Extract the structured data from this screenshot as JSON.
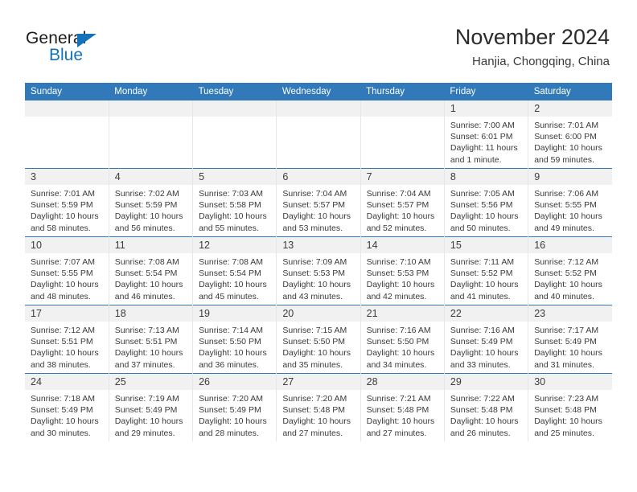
{
  "brand": {
    "name_part1": "General",
    "name_part2": "Blue",
    "triangle_icon": "triangle-icon",
    "primary_color": "#1272bc"
  },
  "header": {
    "title": "November 2024",
    "subtitle": "Hanjia, Chongqing, China"
  },
  "theme": {
    "header_blue": "#3179b8",
    "daynum_bg": "#f1f1f1",
    "cell_border": "#e6e6e6"
  },
  "labels": {
    "sunrise_prefix": "Sunrise:",
    "sunset_prefix": "Sunset:",
    "daylight_prefix": "Daylight:"
  },
  "weekday_headers": [
    "Sunday",
    "Monday",
    "Tuesday",
    "Wednesday",
    "Thursday",
    "Friday",
    "Saturday"
  ],
  "weeks": [
    [
      {
        "day": "",
        "sunrise": "",
        "sunset": "",
        "daylight": ""
      },
      {
        "day": "",
        "sunrise": "",
        "sunset": "",
        "daylight": ""
      },
      {
        "day": "",
        "sunrise": "",
        "sunset": "",
        "daylight": ""
      },
      {
        "day": "",
        "sunrise": "",
        "sunset": "",
        "daylight": ""
      },
      {
        "day": "",
        "sunrise": "",
        "sunset": "",
        "daylight": ""
      },
      {
        "day": "1",
        "sunrise": "Sunrise: 7:00 AM",
        "sunset": "Sunset: 6:01 PM",
        "daylight": "Daylight: 11 hours and 1 minute."
      },
      {
        "day": "2",
        "sunrise": "Sunrise: 7:01 AM",
        "sunset": "Sunset: 6:00 PM",
        "daylight": "Daylight: 10 hours and 59 minutes."
      }
    ],
    [
      {
        "day": "3",
        "sunrise": "Sunrise: 7:01 AM",
        "sunset": "Sunset: 5:59 PM",
        "daylight": "Daylight: 10 hours and 58 minutes."
      },
      {
        "day": "4",
        "sunrise": "Sunrise: 7:02 AM",
        "sunset": "Sunset: 5:59 PM",
        "daylight": "Daylight: 10 hours and 56 minutes."
      },
      {
        "day": "5",
        "sunrise": "Sunrise: 7:03 AM",
        "sunset": "Sunset: 5:58 PM",
        "daylight": "Daylight: 10 hours and 55 minutes."
      },
      {
        "day": "6",
        "sunrise": "Sunrise: 7:04 AM",
        "sunset": "Sunset: 5:57 PM",
        "daylight": "Daylight: 10 hours and 53 minutes."
      },
      {
        "day": "7",
        "sunrise": "Sunrise: 7:04 AM",
        "sunset": "Sunset: 5:57 PM",
        "daylight": "Daylight: 10 hours and 52 minutes."
      },
      {
        "day": "8",
        "sunrise": "Sunrise: 7:05 AM",
        "sunset": "Sunset: 5:56 PM",
        "daylight": "Daylight: 10 hours and 50 minutes."
      },
      {
        "day": "9",
        "sunrise": "Sunrise: 7:06 AM",
        "sunset": "Sunset: 5:55 PM",
        "daylight": "Daylight: 10 hours and 49 minutes."
      }
    ],
    [
      {
        "day": "10",
        "sunrise": "Sunrise: 7:07 AM",
        "sunset": "Sunset: 5:55 PM",
        "daylight": "Daylight: 10 hours and 48 minutes."
      },
      {
        "day": "11",
        "sunrise": "Sunrise: 7:08 AM",
        "sunset": "Sunset: 5:54 PM",
        "daylight": "Daylight: 10 hours and 46 minutes."
      },
      {
        "day": "12",
        "sunrise": "Sunrise: 7:08 AM",
        "sunset": "Sunset: 5:54 PM",
        "daylight": "Daylight: 10 hours and 45 minutes."
      },
      {
        "day": "13",
        "sunrise": "Sunrise: 7:09 AM",
        "sunset": "Sunset: 5:53 PM",
        "daylight": "Daylight: 10 hours and 43 minutes."
      },
      {
        "day": "14",
        "sunrise": "Sunrise: 7:10 AM",
        "sunset": "Sunset: 5:53 PM",
        "daylight": "Daylight: 10 hours and 42 minutes."
      },
      {
        "day": "15",
        "sunrise": "Sunrise: 7:11 AM",
        "sunset": "Sunset: 5:52 PM",
        "daylight": "Daylight: 10 hours and 41 minutes."
      },
      {
        "day": "16",
        "sunrise": "Sunrise: 7:12 AM",
        "sunset": "Sunset: 5:52 PM",
        "daylight": "Daylight: 10 hours and 40 minutes."
      }
    ],
    [
      {
        "day": "17",
        "sunrise": "Sunrise: 7:12 AM",
        "sunset": "Sunset: 5:51 PM",
        "daylight": "Daylight: 10 hours and 38 minutes."
      },
      {
        "day": "18",
        "sunrise": "Sunrise: 7:13 AM",
        "sunset": "Sunset: 5:51 PM",
        "daylight": "Daylight: 10 hours and 37 minutes."
      },
      {
        "day": "19",
        "sunrise": "Sunrise: 7:14 AM",
        "sunset": "Sunset: 5:50 PM",
        "daylight": "Daylight: 10 hours and 36 minutes."
      },
      {
        "day": "20",
        "sunrise": "Sunrise: 7:15 AM",
        "sunset": "Sunset: 5:50 PM",
        "daylight": "Daylight: 10 hours and 35 minutes."
      },
      {
        "day": "21",
        "sunrise": "Sunrise: 7:16 AM",
        "sunset": "Sunset: 5:50 PM",
        "daylight": "Daylight: 10 hours and 34 minutes."
      },
      {
        "day": "22",
        "sunrise": "Sunrise: 7:16 AM",
        "sunset": "Sunset: 5:49 PM",
        "daylight": "Daylight: 10 hours and 33 minutes."
      },
      {
        "day": "23",
        "sunrise": "Sunrise: 7:17 AM",
        "sunset": "Sunset: 5:49 PM",
        "daylight": "Daylight: 10 hours and 31 minutes."
      }
    ],
    [
      {
        "day": "24",
        "sunrise": "Sunrise: 7:18 AM",
        "sunset": "Sunset: 5:49 PM",
        "daylight": "Daylight: 10 hours and 30 minutes."
      },
      {
        "day": "25",
        "sunrise": "Sunrise: 7:19 AM",
        "sunset": "Sunset: 5:49 PM",
        "daylight": "Daylight: 10 hours and 29 minutes."
      },
      {
        "day": "26",
        "sunrise": "Sunrise: 7:20 AM",
        "sunset": "Sunset: 5:49 PM",
        "daylight": "Daylight: 10 hours and 28 minutes."
      },
      {
        "day": "27",
        "sunrise": "Sunrise: 7:20 AM",
        "sunset": "Sunset: 5:48 PM",
        "daylight": "Daylight: 10 hours and 27 minutes."
      },
      {
        "day": "28",
        "sunrise": "Sunrise: 7:21 AM",
        "sunset": "Sunset: 5:48 PM",
        "daylight": "Daylight: 10 hours and 27 minutes."
      },
      {
        "day": "29",
        "sunrise": "Sunrise: 7:22 AM",
        "sunset": "Sunset: 5:48 PM",
        "daylight": "Daylight: 10 hours and 26 minutes."
      },
      {
        "day": "30",
        "sunrise": "Sunrise: 7:23 AM",
        "sunset": "Sunset: 5:48 PM",
        "daylight": "Daylight: 10 hours and 25 minutes."
      }
    ]
  ]
}
